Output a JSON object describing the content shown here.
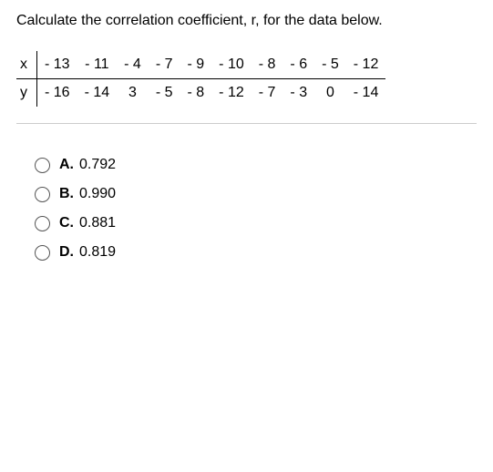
{
  "prompt": "Calculate the correlation coefficient, r, for the data below.",
  "table": {
    "rows": [
      {
        "label": "x",
        "values": [
          "- 13",
          "- 11",
          "- 4",
          "- 7",
          "- 9",
          "- 10",
          "- 8",
          "- 6",
          "- 5",
          "- 12"
        ]
      },
      {
        "label": "y",
        "values": [
          "- 16",
          "- 14",
          "3",
          "- 5",
          "- 8",
          "- 12",
          "- 7",
          "- 3",
          "0",
          "- 14"
        ]
      }
    ]
  },
  "options": [
    {
      "letter": "A.",
      "text": "0.792"
    },
    {
      "letter": "B.",
      "text": "0.990"
    },
    {
      "letter": "C.",
      "text": "0.881"
    },
    {
      "letter": "D.",
      "text": "0.819"
    }
  ]
}
